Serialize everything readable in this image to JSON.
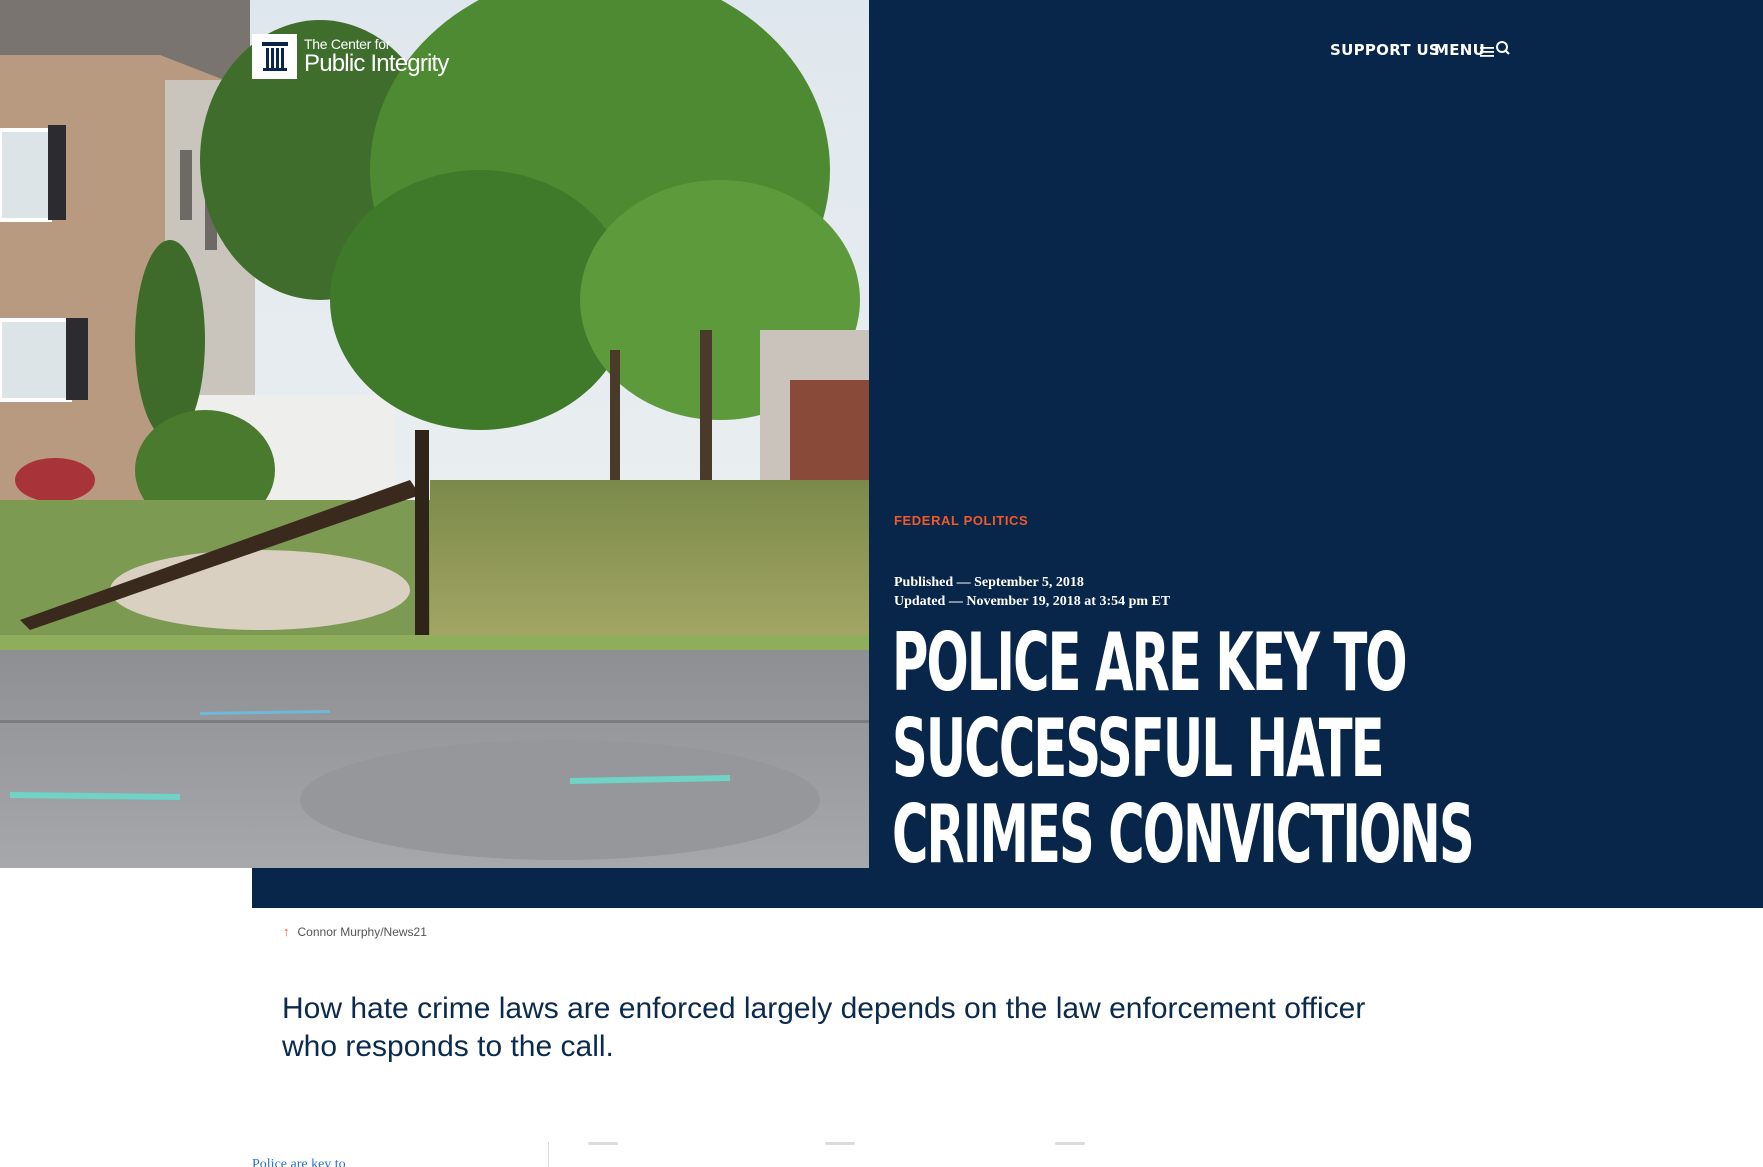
{
  "header": {
    "logo_line1": "The Center for",
    "logo_line2": "Public Integrity",
    "support_label": "SUPPORT US",
    "menu_label": "MENU"
  },
  "article": {
    "category": "FEDERAL POLITICS",
    "published": "Published — September 5, 2018",
    "updated": "Updated — November 19, 2018 at 3:54 pm ET",
    "headline_lines": [
      "POLICE ARE KEY TO",
      "SUCCESSFUL HATE",
      "CRIMES CONVICTIONS"
    ],
    "photo_credit": "Connor Murphy/News21",
    "dek": "How hate crime laws are enforced largely depends on the law enforcement officer who responds to the call."
  },
  "toc": {
    "partial_link": "Police are key to"
  },
  "colors": {
    "navy": "#08264a",
    "accent": "#f05a28",
    "link": "#2a6fd0"
  },
  "icons": {
    "logo": "pillar-icon",
    "menu": "hamburger-icon",
    "search": "search-icon",
    "credit": "arrow-up-icon"
  }
}
